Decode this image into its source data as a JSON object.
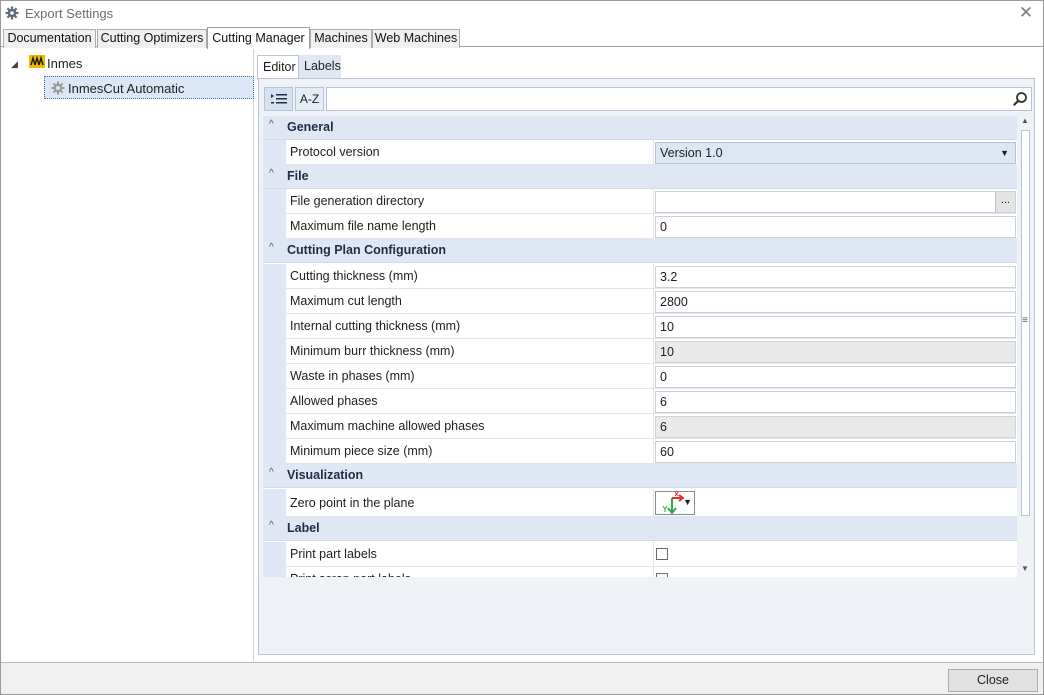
{
  "window": {
    "title": "Export Settings",
    "icon": "gear-icon",
    "close_glyph": "✕"
  },
  "tabs": [
    {
      "label": "Documentation"
    },
    {
      "label": "Cutting Optimizers"
    },
    {
      "label": "Cutting Manager"
    },
    {
      "label": "Machines"
    },
    {
      "label": "Web Machines"
    }
  ],
  "active_tab": "Cutting Manager",
  "tree": {
    "expander_glyph": "◢",
    "root": {
      "label": "Inmes",
      "icon": "inmes-logo-icon"
    },
    "child": {
      "label": "InmesCut Automatic",
      "icon": "gear-icon",
      "selected": true
    }
  },
  "editor_tabs": [
    {
      "label": "Editor"
    },
    {
      "label": "Labels"
    }
  ],
  "toolbar": {
    "categorized_icon": "categorized-list-icon",
    "alphabetical_label": "A-Z",
    "search_value": "",
    "search_icon": "search-icon"
  },
  "grid": {
    "collapse_glyph": "^",
    "combo_glyph": "▼",
    "browse_label": "...",
    "categories": [
      {
        "label": "General",
        "properties": [
          {
            "name": "Protocol version",
            "value": "Version 1.0",
            "type": "combo"
          }
        ]
      },
      {
        "label": "File",
        "properties": [
          {
            "name": "File generation directory",
            "value": "",
            "type": "browse"
          },
          {
            "name": "Maximum file name length",
            "value": "0",
            "type": "text"
          }
        ]
      },
      {
        "label": "Cutting Plan Configuration",
        "properties": [
          {
            "name": "Cutting thickness (mm)",
            "value": "3.2",
            "type": "text"
          },
          {
            "name": "Maximum cut length",
            "value": "2800",
            "type": "text"
          },
          {
            "name": "Internal cutting thickness (mm)",
            "value": "10",
            "type": "text"
          },
          {
            "name": "Minimum burr thickness (mm)",
            "value": "10",
            "type": "readonly"
          },
          {
            "name": "Waste in phases (mm)",
            "value": "0",
            "type": "text"
          },
          {
            "name": "Allowed phases",
            "value": "6",
            "type": "text"
          },
          {
            "name": "Maximum machine allowed phases",
            "value": "6",
            "type": "readonly"
          },
          {
            "name": "Minimum piece size (mm)",
            "value": "60",
            "type": "text"
          }
        ]
      },
      {
        "label": "Visualization",
        "properties": [
          {
            "name": "Zero point in the plane",
            "value": "",
            "type": "zero-point",
            "icon": "axis-origin-icon"
          }
        ]
      },
      {
        "label": "Label",
        "properties": [
          {
            "name": "Print part labels",
            "value": false,
            "type": "checkbox"
          },
          {
            "name": "Print scrap part labels",
            "value": false,
            "type": "checkbox"
          }
        ]
      }
    ]
  },
  "scrollbar": {
    "up_glyph": "▲",
    "down_glyph": "▼",
    "grip_glyph": "≡"
  },
  "footer": {
    "close_label": "Close"
  },
  "colors": {
    "accent": "#dbe7f7",
    "category_bg": "#dee7f3",
    "panel_bg": "#eff3f8",
    "readonly_bg": "#e9e9e9"
  }
}
